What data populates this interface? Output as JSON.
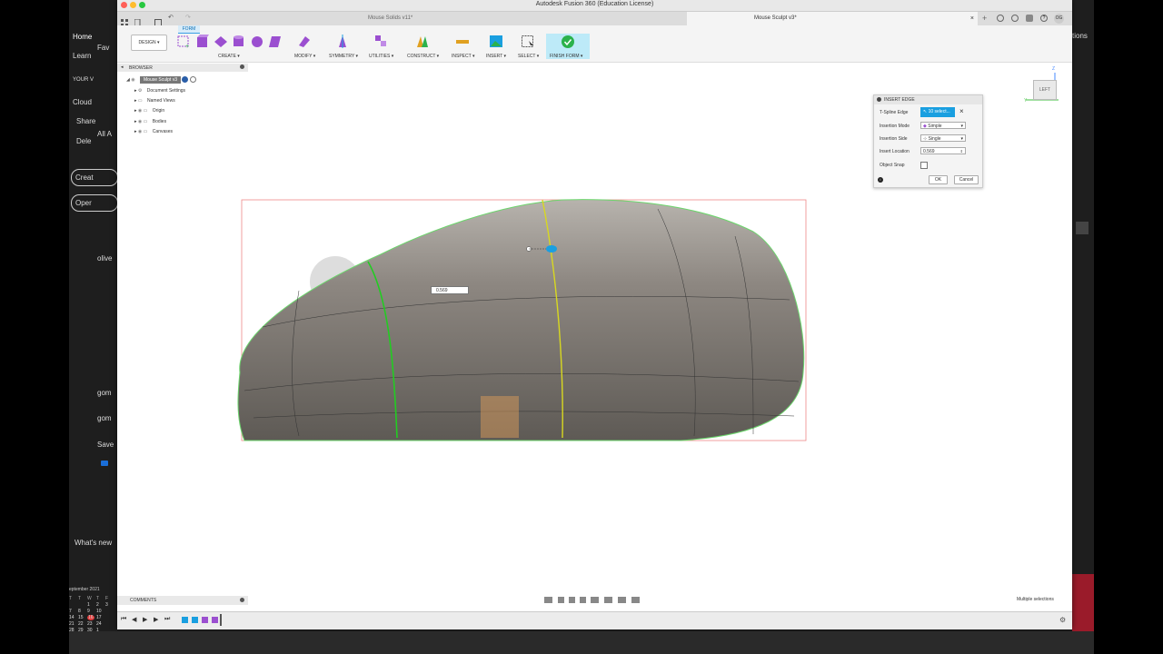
{
  "background_app": {
    "sidebar_items": [
      "Home",
      "Learn",
      "YOUR V",
      "Cloud",
      "Share",
      "Dele",
      "All A",
      "olive",
      "gom",
      "gom",
      "Save"
    ],
    "favorites": "Fav",
    "create_button": "Creat",
    "open_button": "Oper",
    "whats_new": "What's new",
    "right_edge_text": "tions",
    "calendar": {
      "title": "eptember 2021",
      "weekdays": [
        "T",
        "T",
        "W",
        "T",
        "F"
      ],
      "rows": [
        [
          "",
          "",
          "1",
          "2",
          "3"
        ],
        [
          "7",
          "8",
          "9",
          "10",
          ""
        ],
        [
          "14",
          "15",
          "16",
          "17",
          ""
        ],
        [
          "21",
          "22",
          "23",
          "24",
          ""
        ],
        [
          "28",
          "29",
          "30",
          "1",
          ""
        ],
        [
          "",
          "",
          "",
          "",
          "8"
        ]
      ],
      "highlighted": "16",
      "accent_color": "#e03a3a"
    },
    "accent_red": "#9a1b2a"
  },
  "window": {
    "title": "Autodesk Fusion 360 (Education License)",
    "tabs": [
      {
        "label": "Mouse Solids v11*",
        "active": false
      },
      {
        "label": "Mouse Sculpt v3*",
        "active": true
      }
    ],
    "user_initials": "OG"
  },
  "toolbar": {
    "workspace": "DESIGN ▾",
    "active_tab": "FORM",
    "groups": [
      "CREATE ▾",
      "MODIFY ▾",
      "SYMMETRY ▾",
      "UTILITIES ▾",
      "CONSTRUCT ▾",
      "INSPECT ▾",
      "INSERT ▾",
      "SELECT ▾",
      "FINISH FORM ▾"
    ],
    "accent_purple": "#9b4fd0",
    "finish_green": "#2bb24c"
  },
  "browser": {
    "header": "BROWSER",
    "root": "Mouse Sculpt v3",
    "items": [
      "Document Settings",
      "Named Views",
      "Origin",
      "Bodies",
      "Canvases"
    ]
  },
  "dialog": {
    "title": "INSERT EDGE",
    "rows": {
      "tspline_edge": {
        "label": "T-Spline Edge",
        "value": "10 select..."
      },
      "insertion_mode": {
        "label": "Insertion Mode",
        "value": "Simple"
      },
      "insertion_side": {
        "label": "Insertion Side",
        "value": "Single"
      },
      "insert_location": {
        "label": "Insert Location",
        "value": "0.569"
      },
      "object_snap": {
        "label": "Object Snap",
        "checked": false
      }
    },
    "ok": "OK",
    "cancel": "Cancel",
    "selection_color": "#1a9fe0"
  },
  "viewport": {
    "inline_value": "0.569",
    "viewcube_face": "LEFT",
    "axis_labels": {
      "z": "Z",
      "y": "Y"
    }
  },
  "comments": {
    "header": "COMMENTS"
  },
  "status": {
    "text": "Multiple selections"
  }
}
